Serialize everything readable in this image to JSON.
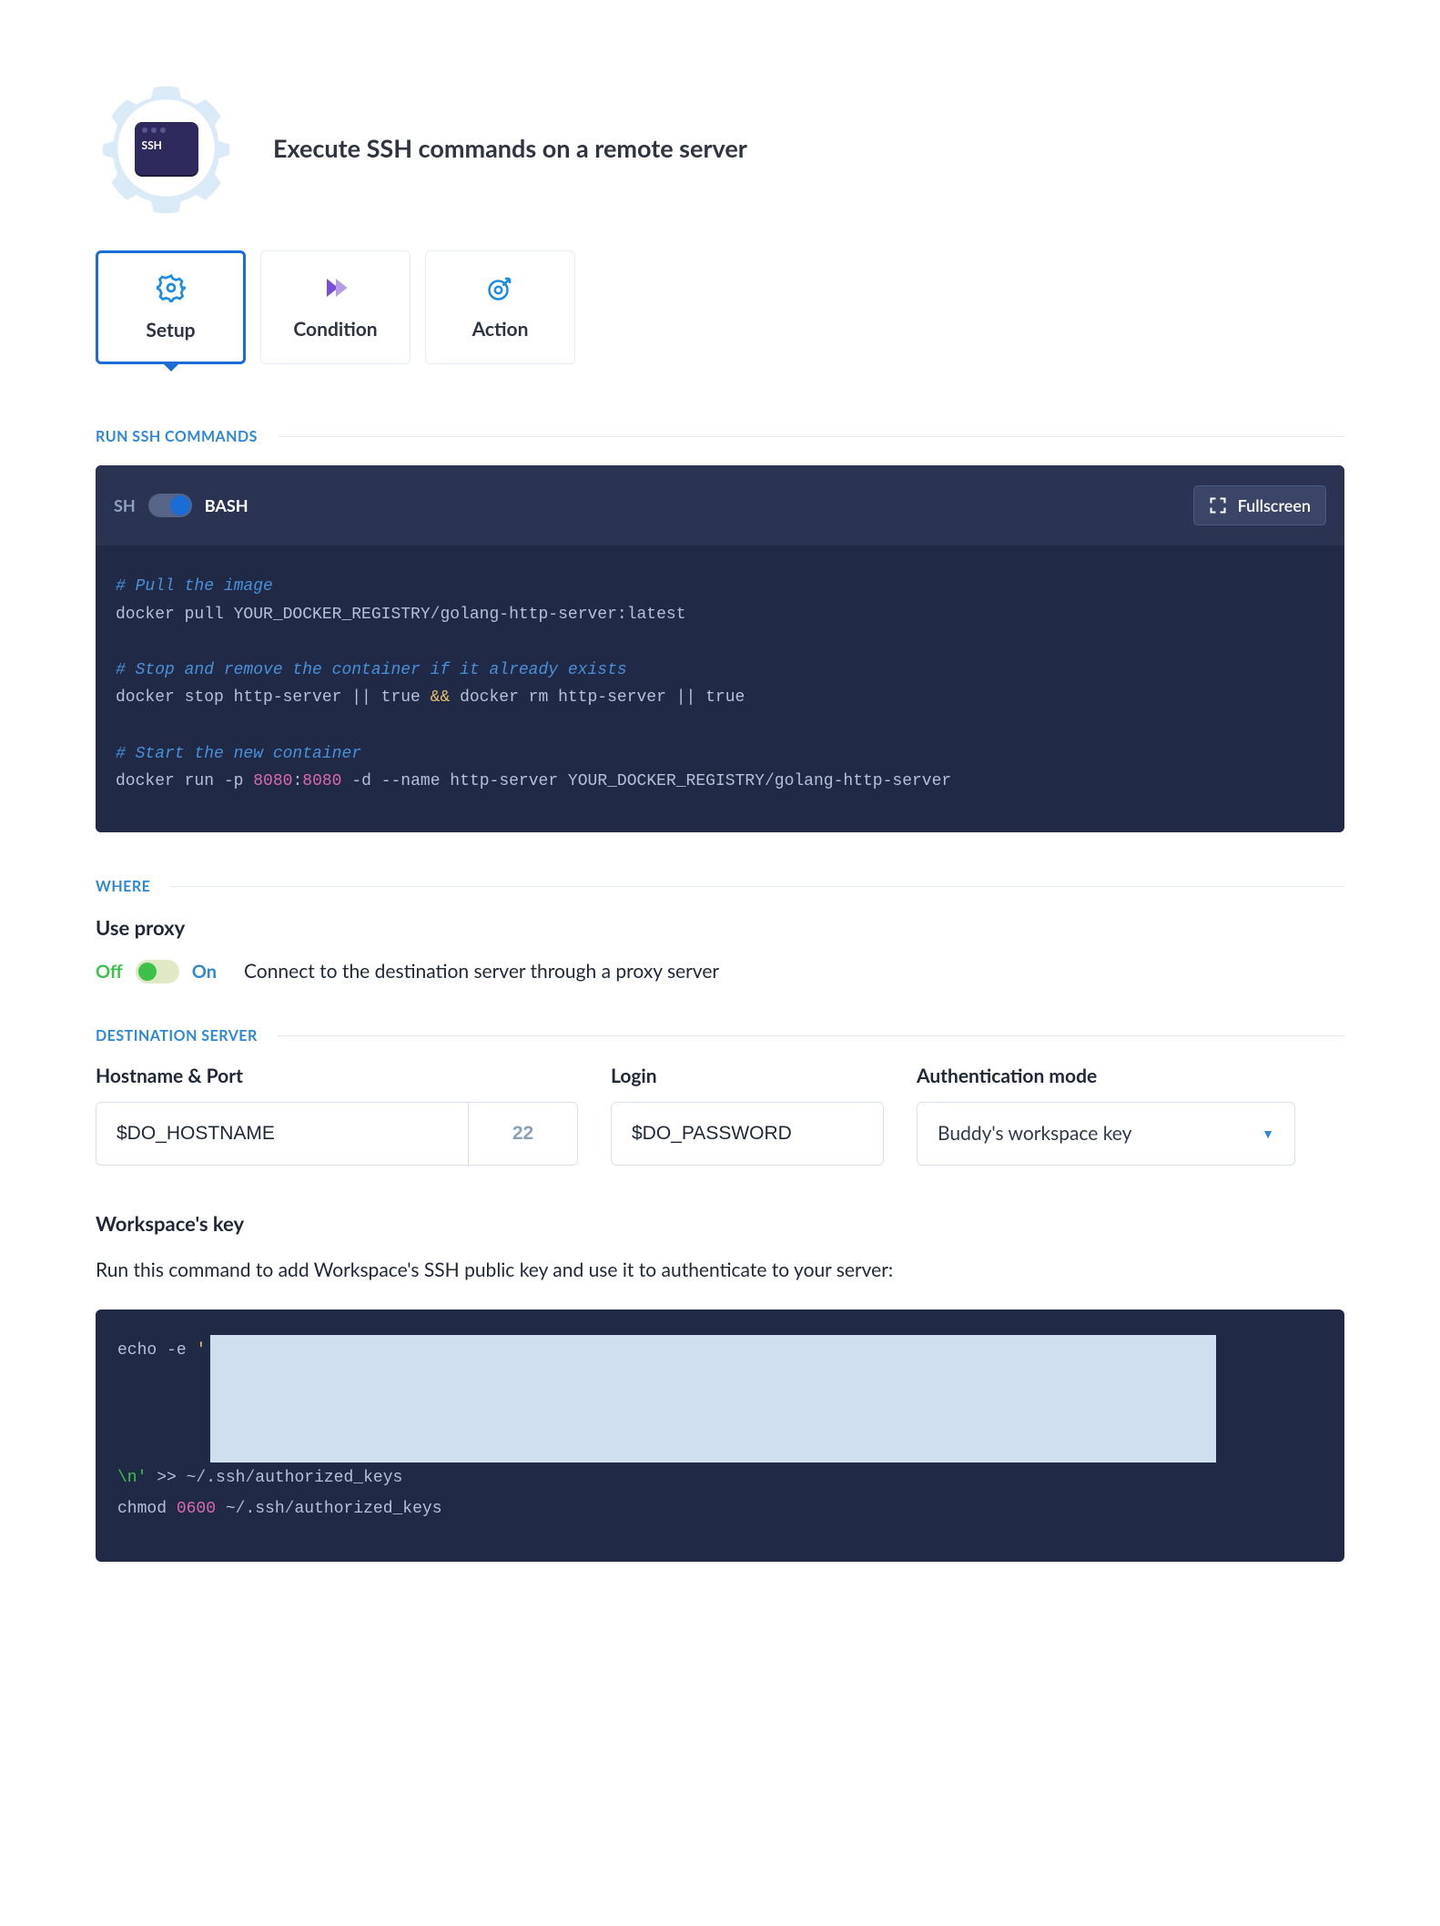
{
  "header": {
    "badge_label": "SSH",
    "title": "Execute SSH commands on a remote server"
  },
  "tabs": {
    "setup": "Setup",
    "condition": "Condition",
    "action": "Action"
  },
  "sections": {
    "run_ssh": "RUN SSH COMMANDS",
    "where": "WHERE",
    "destination": "DESTINATION SERVER"
  },
  "shell_toggle": {
    "left": "SH",
    "right": "BASH"
  },
  "fullscreen_label": "Fullscreen",
  "code": {
    "c1": "# Pull the image",
    "l1a": "docker pull YOUR_DOCKER_REGISTRY",
    "l1b": "golang-http-server:latest",
    "c2": "# Stop and remove the container if it already exists",
    "l2a": "docker stop http-server || true ",
    "l2amp": "&&",
    "l2b": " docker rm http-server || true",
    "c3": "# Start the new container",
    "l3a": "docker run -p ",
    "l3p1": "8080",
    "l3colon": ":",
    "l3p2": "8080",
    "l3b": " -d --name http-server YOUR_DOCKER_REGISTRY",
    "l3c": "golang-http-server"
  },
  "proxy": {
    "title": "Use proxy",
    "off": "Off",
    "on": "On",
    "desc": "Connect to the destination server through a proxy server"
  },
  "dest": {
    "host_label": "Hostname & Port",
    "host_value": "$DO_HOSTNAME",
    "port_value": "22",
    "login_label": "Login",
    "login_value": "$DO_PASSWORD",
    "auth_label": "Authentication mode",
    "auth_value": "Buddy's workspace key"
  },
  "key": {
    "title": "Workspace's key",
    "desc": "Run this command to add Workspace's SSH public key and use it to authenticate to your server:",
    "echo": "echo",
    "flag": "-e",
    "q1": " '",
    "nl_token": "\\n'",
    "redir": " >> ~",
    "slash": "/",
    "p1": ".ssh",
    "p2": "authorized_keys",
    "chmod": "chmod ",
    "perm": "0600",
    "p3": " ~",
    "p4": ".ssh",
    "p5": "authorized_keys"
  }
}
